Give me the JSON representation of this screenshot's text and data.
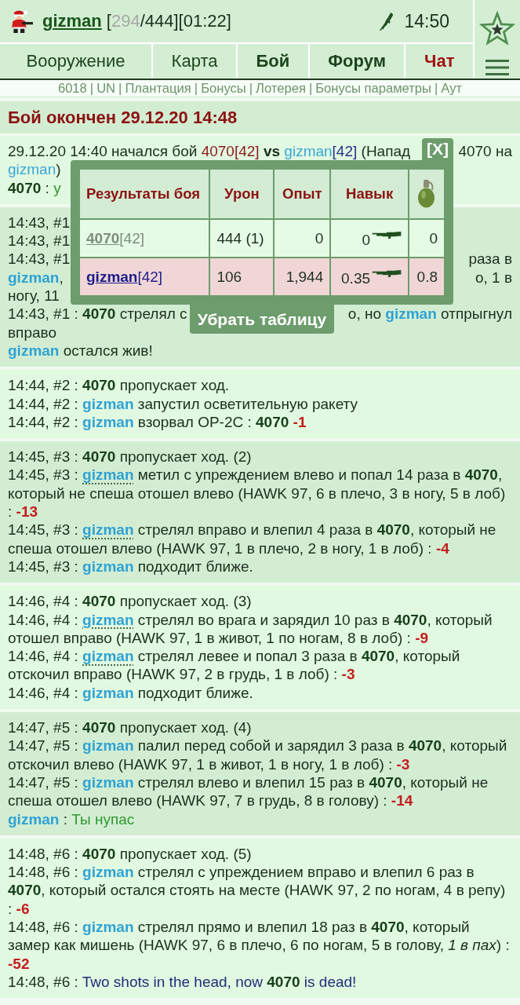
{
  "header": {
    "user": "gizman",
    "stats": [
      {
        "kind": "plain",
        "text": "["
      },
      {
        "kind": "muted",
        "text": "294"
      },
      {
        "kind": "plain",
        "text": "/444][01:22]"
      }
    ],
    "time": "14:50"
  },
  "nav": [
    {
      "label": "Вооружение",
      "kind": "normal"
    },
    {
      "label": "Карта",
      "kind": "normal"
    },
    {
      "label": "Бой",
      "kind": "bold"
    },
    {
      "label": "Форум",
      "kind": "bold"
    },
    {
      "label": "Чат",
      "kind": "alert"
    }
  ],
  "sublinks": {
    "separator": "|",
    "items": [
      "6018",
      "UN",
      "Плантация",
      "Бонусы",
      "Лотерея",
      "Бонусы параметры",
      "Аут"
    ]
  },
  "title": "Бой окончен 29.12.20 14:48",
  "log": [
    {
      "entries": [
        {
          "fragments": [
            [
              {
                "kind": "plain",
                "text": "29.12.20 14:40 начался бой "
              },
              {
                "kind": "enemy_ref",
                "text": "4070[42]"
              },
              {
                "kind": "bold",
                "text": " vs "
              },
              {
                "kind": "player_ref",
                "text": "gizman"
              },
              {
                "kind": "level_ref",
                "text": "[42]"
              },
              {
                "kind": "plain",
                "text": " (Напад"
              }
            ],
            [
              {
                "kind": "plain",
                "text": "4070 на"
              }
            ]
          ]
        },
        {
          "fragments": [
            [
              {
                "kind": "player_ref",
                "text": "gizman"
              },
              {
                "kind": "plain",
                "text": ")"
              }
            ]
          ]
        },
        {
          "fragments": [
            [
              {
                "kind": "enemy",
                "text": "4070"
              },
              {
                "kind": "plain",
                "text": " : "
              },
              {
                "kind": "chat",
                "text": "у"
              }
            ]
          ]
        }
      ]
    },
    {
      "entries": [
        {
          "fragments": [
            [
              {
                "kind": "plain",
                "text": "14:43, #1"
              }
            ]
          ]
        },
        {
          "fragments": [
            [
              {
                "kind": "plain",
                "text": "14:43, #1"
              }
            ]
          ]
        },
        {
          "fragments": [
            [
              {
                "kind": "plain",
                "text": "14:43, #1"
              }
            ],
            [
              {
                "kind": "plain",
                "text": "раза в"
              }
            ]
          ]
        },
        {
          "fragments": [
            [
              {
                "kind": "player",
                "text": "gizman"
              },
              {
                "kind": "plain",
                "text": ","
              }
            ],
            [
              {
                "kind": "plain",
                "text": "о, 1 в"
              }
            ]
          ]
        },
        {
          "fragments": [
            [
              {
                "kind": "plain",
                "text": "ногу, 11"
              }
            ]
          ]
        },
        {
          "fragments": [
            [
              {
                "kind": "plain",
                "text": "14:43, #1 : "
              },
              {
                "kind": "enemy",
                "text": "4070"
              },
              {
                "kind": "plain",
                "text": " стрелял с"
              }
            ],
            [
              {
                "kind": "plain",
                "text": "о, но "
              },
              {
                "kind": "player",
                "text": "gizman"
              },
              {
                "kind": "plain",
                "text": " отпрыгнул"
              }
            ]
          ]
        },
        {
          "fragments": [
            [
              {
                "kind": "plain",
                "text": "вправо"
              }
            ]
          ]
        },
        {
          "fragments": [
            [
              {
                "kind": "player",
                "text": "gizman"
              },
              {
                "kind": "plain",
                "text": " остался жив!"
              }
            ]
          ]
        }
      ]
    },
    {
      "entries": [
        {
          "fragments": [
            [
              {
                "kind": "plain",
                "text": "14:44, #2 : "
              },
              {
                "kind": "enemy",
                "text": "4070"
              },
              {
                "kind": "plain",
                "text": " пропускает ход."
              }
            ]
          ]
        },
        {
          "fragments": [
            [
              {
                "kind": "plain",
                "text": "14:44, #2 : "
              },
              {
                "kind": "player",
                "text": "gizman"
              },
              {
                "kind": "plain",
                "text": " запустил осветительную ракету"
              }
            ]
          ]
        },
        {
          "fragments": [
            [
              {
                "kind": "plain",
                "text": "14:44, #2 : "
              },
              {
                "kind": "player",
                "text": "gizman"
              },
              {
                "kind": "plain",
                "text": " взорвал ОР-2С : "
              },
              {
                "kind": "enemy",
                "text": "4070"
              },
              {
                "kind": "damage",
                "text": " -1"
              }
            ]
          ]
        }
      ]
    },
    {
      "entries": [
        {
          "fragments": [
            [
              {
                "kind": "plain",
                "text": "14:45, #3 : "
              },
              {
                "kind": "enemy",
                "text": "4070"
              },
              {
                "kind": "plain",
                "text": " пропускает ход. (2)"
              }
            ]
          ]
        },
        {
          "fragments": [
            [
              {
                "kind": "plain",
                "text": "14:45, #3 : "
              },
              {
                "kind": "player_tip",
                "text": "gizman"
              },
              {
                "kind": "plain",
                "text": " метил с упреждением влево и попал 14 раза в "
              },
              {
                "kind": "enemy",
                "text": "4070"
              },
              {
                "kind": "plain",
                "text": ", который не спеша отошел влево (HAWK 97, 6 в плечо, 3 в ногу, 5 в лоб) : "
              },
              {
                "kind": "damage",
                "text": "-13"
              }
            ]
          ]
        },
        {
          "fragments": [
            [
              {
                "kind": "plain",
                "text": "14:45, #3 : "
              },
              {
                "kind": "player_tip",
                "text": "gizman"
              },
              {
                "kind": "plain",
                "text": " стрелял вправо и влепил 4 раза в "
              },
              {
                "kind": "enemy",
                "text": "4070"
              },
              {
                "kind": "plain",
                "text": ", который не спеша отошел влево (HAWK 97, 1 в плечо, 2 в ногу, 1 в лоб) : "
              },
              {
                "kind": "damage",
                "text": "-4"
              }
            ]
          ]
        },
        {
          "fragments": [
            [
              {
                "kind": "plain",
                "text": "14:45, #3 : "
              },
              {
                "kind": "player",
                "text": "gizman"
              },
              {
                "kind": "plain",
                "text": " подходит ближе."
              }
            ]
          ]
        }
      ]
    },
    {
      "entries": [
        {
          "fragments": [
            [
              {
                "kind": "plain",
                "text": "14:46, #4 : "
              },
              {
                "kind": "enemy",
                "text": "4070"
              },
              {
                "kind": "plain",
                "text": " пропускает ход. (3)"
              }
            ]
          ]
        },
        {
          "fragments": [
            [
              {
                "kind": "plain",
                "text": "14:46, #4 : "
              },
              {
                "kind": "player_tip",
                "text": "gizman"
              },
              {
                "kind": "plain",
                "text": " стрелял во врага и зарядил 10 раз в "
              },
              {
                "kind": "enemy",
                "text": "4070"
              },
              {
                "kind": "plain",
                "text": ", который отошел вправо (HAWK 97, 1 в живот, 1 по ногам, 8 в лоб) : "
              },
              {
                "kind": "damage",
                "text": "-9"
              }
            ]
          ]
        },
        {
          "fragments": [
            [
              {
                "kind": "plain",
                "text": "14:46, #4 : "
              },
              {
                "kind": "player_tip",
                "text": "gizman"
              },
              {
                "kind": "plain",
                "text": " стрелял левее и попал 3 раза в "
              },
              {
                "kind": "enemy",
                "text": "4070"
              },
              {
                "kind": "plain",
                "text": ", который отскочил вправо (HAWK 97, 2 в грудь, 1 в лоб) : "
              },
              {
                "kind": "damage",
                "text": "-3"
              }
            ]
          ]
        },
        {
          "fragments": [
            [
              {
                "kind": "plain",
                "text": "14:46, #4 : "
              },
              {
                "kind": "player",
                "text": "gizman"
              },
              {
                "kind": "plain",
                "text": " подходит ближе."
              }
            ]
          ]
        }
      ]
    },
    {
      "entries": [
        {
          "fragments": [
            [
              {
                "kind": "plain",
                "text": "14:47, #5 : "
              },
              {
                "kind": "enemy",
                "text": "4070"
              },
              {
                "kind": "plain",
                "text": " пропускает ход. (4)"
              }
            ]
          ]
        },
        {
          "fragments": [
            [
              {
                "kind": "plain",
                "text": "14:47, #5 : "
              },
              {
                "kind": "player",
                "text": "gizman"
              },
              {
                "kind": "plain",
                "text": " палил перед собой и зарядил 3 раза в "
              },
              {
                "kind": "enemy",
                "text": "4070"
              },
              {
                "kind": "plain",
                "text": ", который отскочил влево (HAWK 97, 1 в живот, 1 в ногу, 1 в лоб) : "
              },
              {
                "kind": "damage",
                "text": "-3"
              }
            ]
          ]
        },
        {
          "fragments": [
            [
              {
                "kind": "plain",
                "text": "14:47, #5 : "
              },
              {
                "kind": "player",
                "text": "gizman"
              },
              {
                "kind": "plain",
                "text": " стрелял влево и влепил 15 раз в "
              },
              {
                "kind": "enemy",
                "text": "4070"
              },
              {
                "kind": "plain",
                "text": ", который не спеша отошел влево (HAWK 97, 7 в грудь, 8 в голову) : "
              },
              {
                "kind": "damage",
                "text": "-14"
              }
            ]
          ]
        },
        {
          "fragments": [
            [
              {
                "kind": "player",
                "text": "gizman"
              },
              {
                "kind": "plain",
                "text": " : "
              },
              {
                "kind": "chat",
                "text": "Ты нупас"
              }
            ]
          ]
        }
      ]
    },
    {
      "entries": [
        {
          "fragments": [
            [
              {
                "kind": "plain",
                "text": "14:48, #6 : "
              },
              {
                "kind": "enemy",
                "text": "4070"
              },
              {
                "kind": "plain",
                "text": " пропускает ход. (5)"
              }
            ]
          ]
        },
        {
          "fragments": [
            [
              {
                "kind": "plain",
                "text": "14:48, #6 : "
              },
              {
                "kind": "player",
                "text": "gizman"
              },
              {
                "kind": "plain",
                "text": " стрелял с упреждением вправо и влепил 6 раз в "
              },
              {
                "kind": "enemy",
                "text": "4070"
              },
              {
                "kind": "plain",
                "text": ", который остался стоять на месте (HAWK 97, 2 по ногам, 4 в репу) : "
              },
              {
                "kind": "damage",
                "text": "-6"
              }
            ]
          ]
        },
        {
          "fragments": [
            [
              {
                "kind": "plain",
                "text": "14:48, #6 : "
              },
              {
                "kind": "player",
                "text": "gizman"
              },
              {
                "kind": "plain",
                "text": " стрелял прямо и влепил 18 раз в "
              },
              {
                "kind": "enemy",
                "text": "4070"
              },
              {
                "kind": "plain",
                "text": ", который замер как мишень (HAWK 97, 6 в плечо, 6 по ногам, 5 в голову, "
              },
              {
                "kind": "italic",
                "text": "1 в пах"
              },
              {
                "kind": "plain",
                "text": ") : "
              },
              {
                "kind": "damage",
                "text": "-52"
              }
            ]
          ]
        },
        {
          "fragments": [
            [
              {
                "kind": "plain",
                "text": "14:48, #6 : "
              },
              {
                "kind": "system",
                "text": "Two shots in the head, now "
              },
              {
                "kind": "enemy",
                "text": "4070"
              },
              {
                "kind": "system",
                "text": " is dead!"
              }
            ]
          ]
        }
      ]
    }
  ],
  "popup": {
    "close": "[X]",
    "columns": [
      {
        "kind": "text",
        "label": "Результаты боя"
      },
      {
        "kind": "text",
        "label": "Урон"
      },
      {
        "kind": "text",
        "label": "Опыт"
      },
      {
        "kind": "text",
        "label": "Навык"
      },
      {
        "kind": "icon"
      }
    ],
    "rows": [
      {
        "player": "4070",
        "rank": "[42]",
        "dead": true,
        "highlighted": false,
        "damage": "444 (1)",
        "experience": "0",
        "skill": "0",
        "column_5": "0"
      },
      {
        "player": "gizman",
        "rank": "[42]",
        "dead": false,
        "highlighted": true,
        "damage": "106",
        "experience": "1,944",
        "skill": "0.35",
        "column_5": "0.8"
      }
    ],
    "hide_button": "Убрать таблицу"
  }
}
